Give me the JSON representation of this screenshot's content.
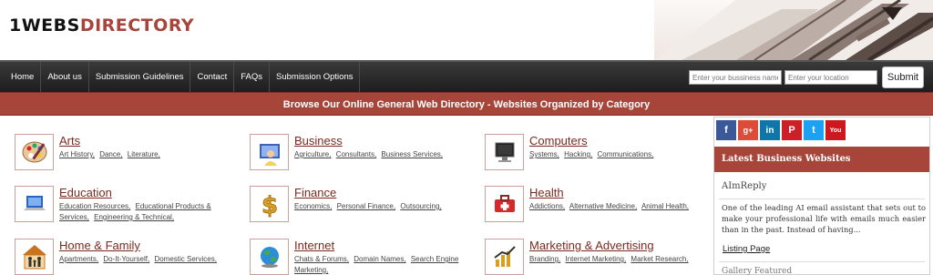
{
  "logo": {
    "part1": "1WEBS",
    "part2": "DIRECTORY"
  },
  "nav": {
    "items": [
      "Home",
      "About us",
      "Submission Guidelines",
      "Contact",
      "FAQs",
      "Submission Options"
    ],
    "search": {
      "business_placeholder": "Enter your bussiness name",
      "location_placeholder": "Enter your location",
      "submit_label": "Submit"
    }
  },
  "banner": "Browse Our Online General Web Directory - Websites Organized by Category",
  "categories": [
    {
      "title": "Arts",
      "icon": "palette-icon",
      "subs": [
        "Art History,",
        "Dance,",
        "Literature,"
      ]
    },
    {
      "title": "Business",
      "icon": "businessman-icon",
      "subs": [
        "Agriculture,",
        "Consultants,",
        "Business Services,"
      ]
    },
    {
      "title": "Computers",
      "icon": "computer-monitor-icon",
      "subs": [
        "Systems,",
        "Hacking,",
        "Communications,"
      ]
    },
    {
      "title": "Education",
      "icon": "laptop-icon",
      "subs": [
        "Education Resources,",
        "Educational Products & Services,",
        "Engineering & Technical,"
      ]
    },
    {
      "title": "Finance",
      "icon": "dollar-icon",
      "subs": [
        "Economics,",
        "Personal Finance,",
        "Outsourcing,"
      ]
    },
    {
      "title": "Health",
      "icon": "first-aid-kit-icon",
      "subs": [
        "Addictions,",
        "Alternative Medicine,",
        "Animal Health,"
      ]
    },
    {
      "title": "Home & Family",
      "icon": "family-house-icon",
      "subs": [
        "Apartments,",
        "Do-It-Yourself,",
        "Domestic Services,"
      ]
    },
    {
      "title": "Internet",
      "icon": "globe-icon",
      "subs": [
        "Chats & Forums,",
        "Domain Names,",
        "Search Engine Marketing,"
      ]
    },
    {
      "title": "Marketing & Advertising",
      "icon": "chart-icon",
      "subs": [
        "Branding,",
        "Internet Marketing,",
        "Market Research,"
      ]
    }
  ],
  "sidebar": {
    "social": [
      {
        "name": "facebook-icon",
        "glyph": "f",
        "color": "#3b5998"
      },
      {
        "name": "google-plus-icon",
        "glyph": "g+",
        "color": "#dd4b39"
      },
      {
        "name": "linkedin-icon",
        "glyph": "in",
        "color": "#0e76a8"
      },
      {
        "name": "pinterest-icon",
        "glyph": "P",
        "color": "#cb2027"
      },
      {
        "name": "twitter-icon",
        "glyph": "t",
        "color": "#1da1f2"
      },
      {
        "name": "youtube-icon",
        "glyph": "You",
        "color": "#cc181e"
      }
    ],
    "latest_title": "Latest Business Websites",
    "business_name": "AImReply",
    "business_desc": "One of the leading AI email assistant that sets out to make your professional life with emails much easier than in the past. Instead of having...",
    "listing_link": "Listing Page",
    "more_heading": "Gallery Featured"
  },
  "colors": {
    "brand": "#a8453a",
    "nav_bg": "#1c1c1c"
  }
}
